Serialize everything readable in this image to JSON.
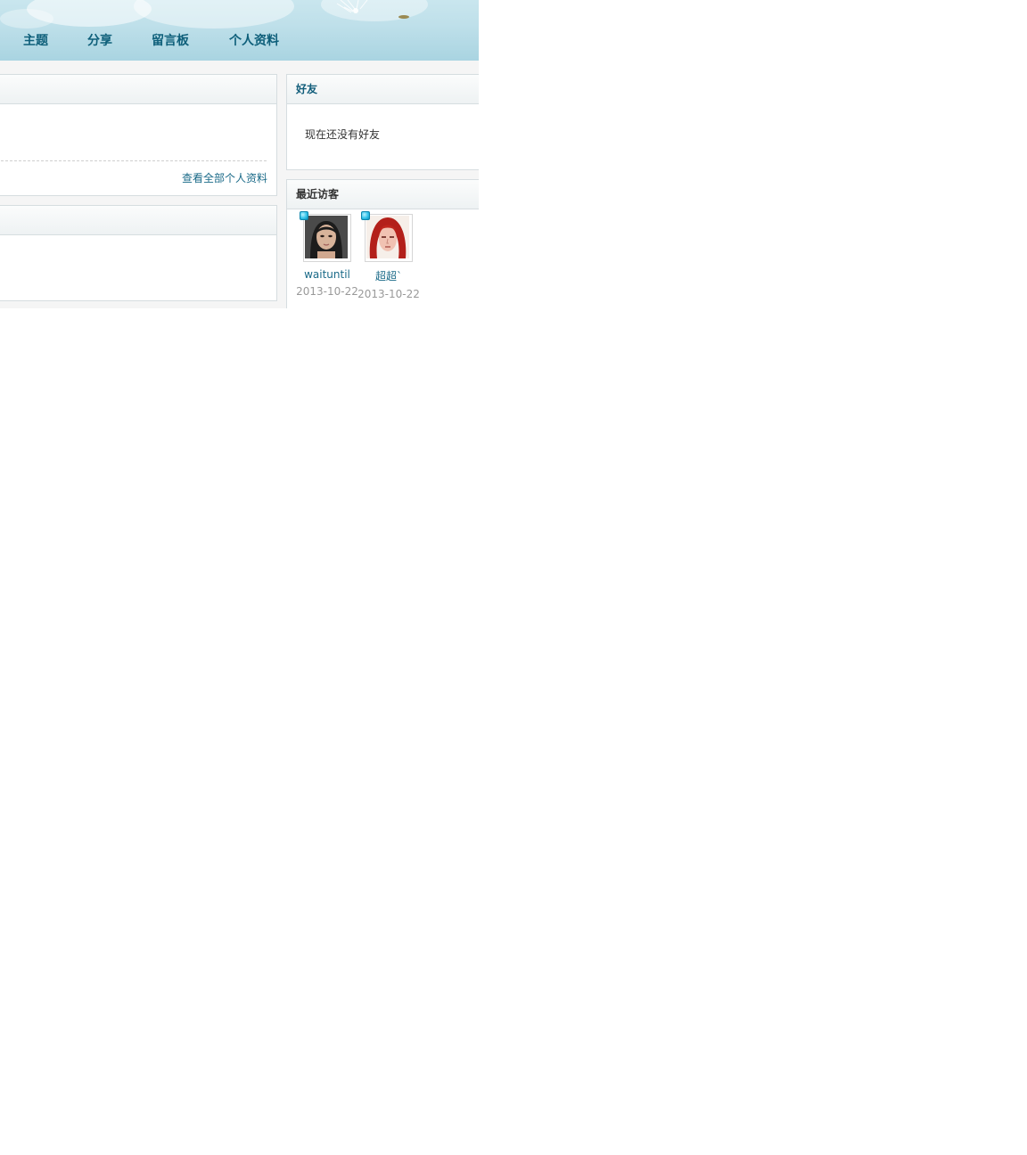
{
  "nav": {
    "items": [
      {
        "label": "主题"
      },
      {
        "label": "分享"
      },
      {
        "label": "留言板"
      },
      {
        "label": "个人资料"
      }
    ]
  },
  "profile_panel": {
    "view_all_label": "查看全部个人资料"
  },
  "friends_panel": {
    "title": "好友",
    "empty_message": "现在还没有好友"
  },
  "visitors_panel": {
    "title": "最近访客",
    "visitors": [
      {
        "name": "waituntil",
        "date": "2013-10-22"
      },
      {
        "name": "超超`",
        "date": "2013-10-22"
      }
    ]
  },
  "colors": {
    "link": "#1a6a88",
    "nav": "#0e5f7a",
    "online": "#33c3ea"
  }
}
